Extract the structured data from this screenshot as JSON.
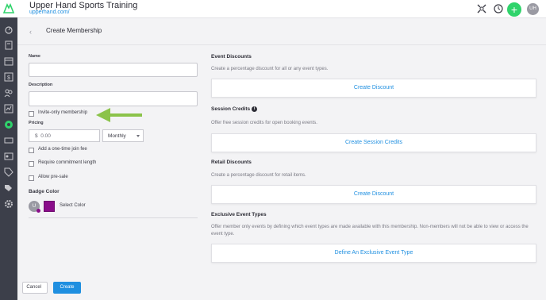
{
  "header": {
    "title": "Upper Hand Sports Training",
    "url": "upperhand.com/",
    "avatar_initials": "UH"
  },
  "page": {
    "title": "Create Membership",
    "back_icon": "‹"
  },
  "form": {
    "name_label": "Name",
    "name_value": "",
    "description_label": "Description",
    "description_value": "",
    "invite_only_label": "Invite-only membership",
    "pricing_label": "Pricing",
    "price_prefix": "$",
    "price_value": "0.00",
    "billing_period": "Monthly",
    "join_fee_label": "Add a one-time join fee",
    "commitment_label": "Require commitment length",
    "presale_label": "Allow pre-sale",
    "badge_color_label": "Badge Color",
    "badge_preview_initial": "U",
    "badge_color": "#8a0d8a",
    "select_color_label": "Select Color"
  },
  "sections": {
    "event_discounts": {
      "title": "Event Discounts",
      "description": "Create a percentage discount for all or any event types.",
      "button": "Create Discount"
    },
    "session_credits": {
      "title": "Session Credits",
      "description": "Offer free session credits for open booking events.",
      "button": "Create Session Credits"
    },
    "retail_discounts": {
      "title": "Retail Discounts",
      "description": "Create a percentage discount for retail items.",
      "button": "Create Discount"
    },
    "exclusive_event_types": {
      "title": "Exclusive Event Types",
      "description": "Offer member only events by defining which event types are made available with this membership. Non-members will not be able to view or access the event type.",
      "button": "Define An Exclusive Event Type"
    }
  },
  "footer": {
    "cancel_label": "Cancel",
    "create_label": "Create"
  },
  "colors": {
    "accent": "#1f8fe0",
    "sidebar": "#3c3f4a",
    "add_button": "#2fd36b",
    "arrow": "#8bc34a"
  }
}
